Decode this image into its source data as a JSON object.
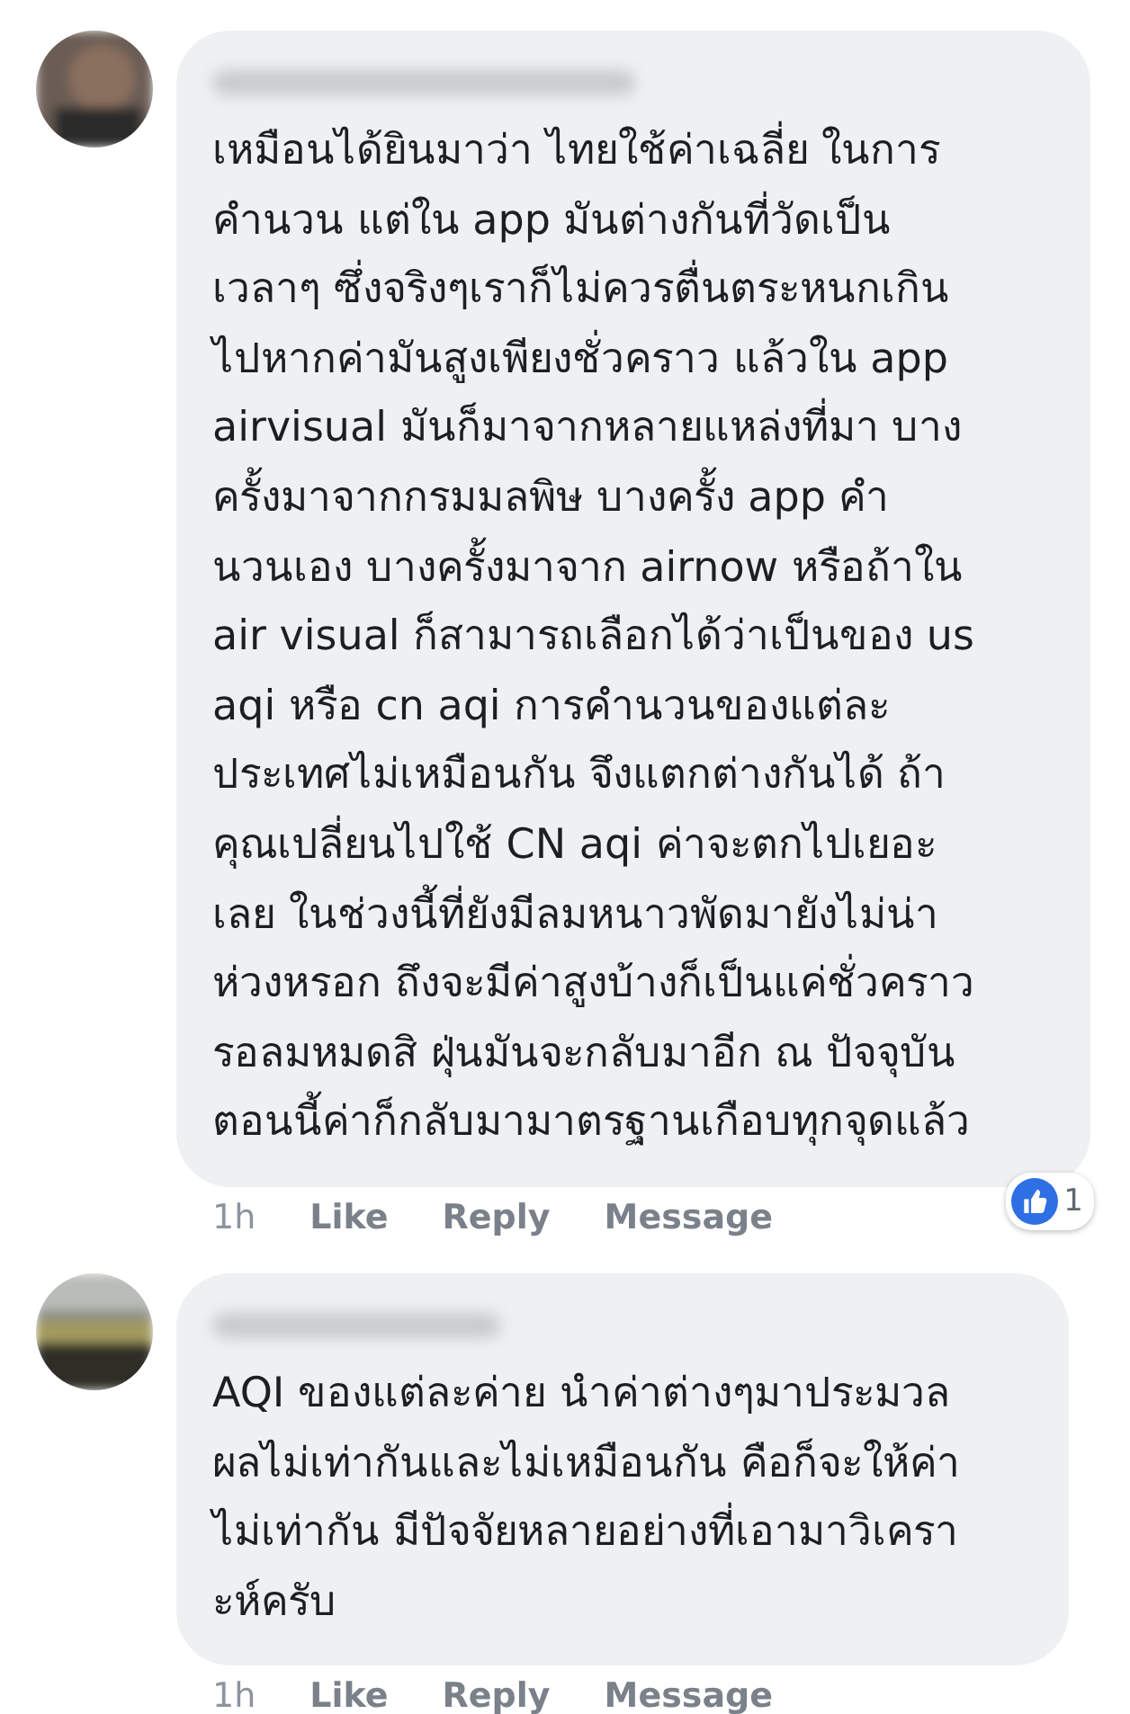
{
  "comments": [
    {
      "avatar": {
        "kind": "picture"
      },
      "text_lines": [
        "เหมือนได้ยินมาว่า ไทยใช้ค่าเฉลี่ย ในการ",
        "คำนวน แต่ใน app มันต่างกันที่วัดเป็น",
        "เวลาๆ ซึ่งจริงๆเราก็ไม่ควรตื่นตระหนกเกิน",
        "ไปหากค่ามันสูงเพียงชั่วคราว แล้วใน app",
        "airvisual มันก็มาจากหลายแหล่งที่มา บาง",
        "ครั้งมาจากกรมมลพิษ บางครั้ง app คำ",
        "นวนเอง บางครั้งมาจาก airnow  หรือถ้าใน",
        "air visual ก็สามารถเลือกได้ว่าเป็นของ us",
        "aqi หรือ cn aqi การคำนวนของแต่ละ",
        "ประเทศไม่เหมือนกัน จึงแตกต่างกันได้ ถ้า",
        "คุณเปลี่ยนไปใช้ CN aqi ค่าจะตกไปเยอะ",
        "เลย ในช่วงนี้ที่ยังมีลมหนาวพัดมายังไม่น่า",
        "ห่วงหรอก ถึงจะมีค่าสูงบ้างก็เป็นแค่ชั่วคราว",
        "รอลมหมดสิ ฝุ่นมันจะกลับมาอีก ณ ปัจจุบัน",
        "ตอนนี้ค่าก็กลับมามาตรฐานเกือบทุกจุดแล้ว"
      ],
      "time": "1h",
      "actions": [
        "Like",
        "Reply",
        "Message"
      ],
      "reactions": {
        "count": "1"
      }
    },
    {
      "avatar": {
        "kind": "picture"
      },
      "text_lines": [
        "AQI ของแต่ละค่าย นำค่าต่างๆมาประมวล",
        "ผลไม่เท่ากันและไม่เหมือนกัน คือก็จะให้ค่า",
        "ไม่เท่ากัน มีปัจจัยหลายอย่างที่เอามาวิเครา",
        "ะห์ครับ"
      ],
      "time": "1h",
      "actions": [
        "Like",
        "Reply",
        "Message"
      ]
    }
  ]
}
